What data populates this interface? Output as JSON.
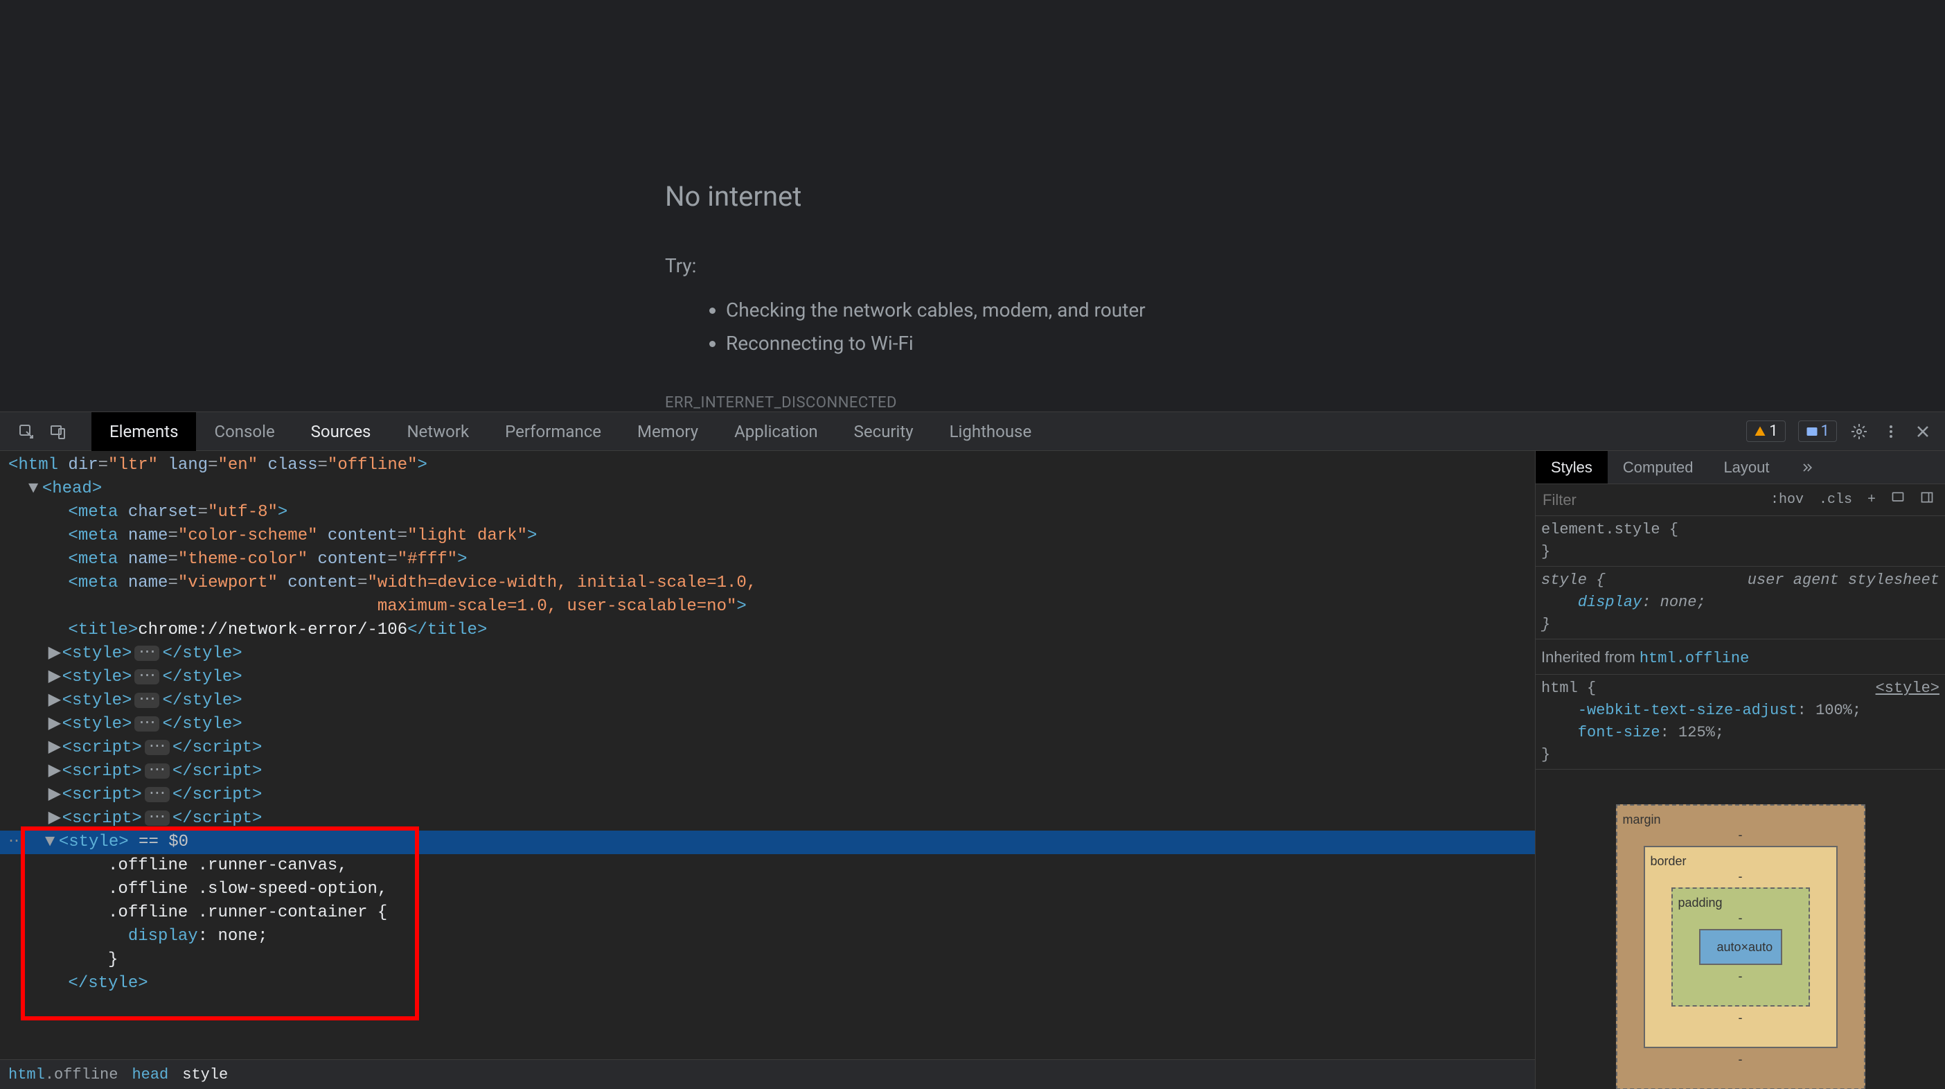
{
  "page": {
    "heading": "No internet",
    "try_label": "Try:",
    "suggestions": [
      "Checking the network cables, modem, and router",
      "Reconnecting to Wi-Fi"
    ],
    "error_code": "ERR_INTERNET_DISCONNECTED"
  },
  "devtools": {
    "tabs": [
      "Elements",
      "Console",
      "Sources",
      "Network",
      "Performance",
      "Memory",
      "Application",
      "Security",
      "Lighthouse"
    ],
    "active_tab": "Elements",
    "warnings": "1",
    "infos": "1"
  },
  "dom": {
    "line_html_open": "<html dir=\"ltr\" lang=\"en\" class=\"offline\">",
    "line_head_open": "<head>",
    "meta_charset": {
      "tag": "<meta ",
      "attrs": "charset=\"utf-8\"",
      "close": ">"
    },
    "meta_color_scheme": {
      "tag": "<meta ",
      "n1": "name",
      "v1": "color-scheme",
      "n2": "content",
      "v2": "light dark",
      "close": ">"
    },
    "meta_theme": {
      "tag": "<meta ",
      "n1": "name",
      "v1": "theme-color",
      "n2": "content",
      "v2": "#fff",
      "close": ">"
    },
    "meta_viewport": {
      "tag": "<meta ",
      "n1": "name",
      "v1": "viewport",
      "n2": "content",
      "v2": "width=device-width, initial-scale=1.0,",
      "v2b": "maximum-scale=1.0, user-scalable=no",
      "close": ">"
    },
    "title": {
      "open": "<title>",
      "text": "chrome://network-error/-106",
      "close": "</title>"
    },
    "style_collapsed": {
      "open": "<style>",
      "close": "</style>"
    },
    "script_collapsed": {
      "open": "<script>",
      "close": "</script>"
    },
    "selected": {
      "open": "<style>",
      "marker": " == $0"
    },
    "css_l1": ".offline .runner-canvas,",
    "css_l2": ".offline .slow-speed-option,",
    "css_l3": ".offline .runner-container {",
    "css_l4_prop": "display",
    "css_l4_val": ": none;",
    "css_l5": "}",
    "close_style": "</style>"
  },
  "breadcrumb": {
    "items": [
      {
        "text": "html",
        "suffix": ".offline"
      },
      {
        "text": "head"
      },
      {
        "text": "style"
      }
    ]
  },
  "styles": {
    "tabs": [
      "Styles",
      "Computed",
      "Layout"
    ],
    "active_tab": "Styles",
    "filter_placeholder": "Filter",
    "btns": {
      "hov": ":hov",
      "cls": ".cls",
      "plus": "+"
    },
    "element_style": "element.style {",
    "close_brace": "}",
    "style_rule": {
      "sel": "style {",
      "prop": "display",
      "val": ": none;",
      "uas": "user agent stylesheet"
    },
    "inherited_label": "Inherited from ",
    "inherited_sel": "html.offline",
    "html_rule": {
      "sel": "html {",
      "link": "<style>",
      "p1": "-webkit-text-size-adjust",
      "v1": ": 100%;",
      "p2": "font-size",
      "v2": ": 125%;"
    },
    "box_model": {
      "margin": "margin",
      "border": "border",
      "padding": "padding",
      "content": "auto×auto",
      "dash": "-"
    }
  }
}
